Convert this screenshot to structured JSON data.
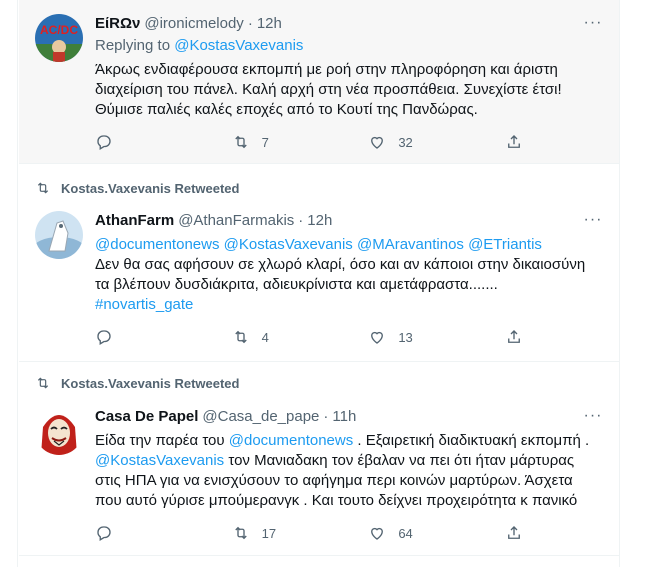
{
  "tweets": [
    {
      "author": "ΕίRΩν",
      "handle": "@ironicmelody",
      "dot": "·",
      "time": "12h",
      "replying_prefix": "Replying to",
      "replying_to": "@KostasVaxevanis",
      "lines": [
        "Άκρως ενδιαφέρουσα  εκπομπή με ροή στην πληροφόρηση και άριστη",
        "διαχείριση του πάνελ. Καλή αρχή στη νέα προσπάθεια. Συνεχίστε έτσι!",
        "Θύμισε παλιές καλές εποχές από το Κουτί της Πανδώρας."
      ],
      "retweets": "7",
      "likes": "32"
    },
    {
      "retweeted_by": "Kostas.Vaxevanis Retweeted",
      "author": "AthanFarm",
      "handle": "@AthanFarmakis",
      "dot": "·",
      "time": "12h",
      "mentions": "@documentonews  @KostasVaxevanis @MAravantinos @ETriantis",
      "lines": [
        "Δεν θα σας αφήσουν σε χλωρό κλαρί, όσο και αν κάποιοι στην δικαιοσύνη",
        "τα βλέπουν δυσδιάκριτα, αδιευκρίνιστα και αμετάφραστα......."
      ],
      "hashtag": "#novartis_gate",
      "retweets": "4",
      "likes": "13"
    },
    {
      "retweeted_by": "Kostas.Vaxevanis Retweeted",
      "author": "Casa De Papel",
      "handle": "@Casa_de_pape",
      "dot": "·",
      "time": "11h",
      "line1_pre": "Είδα την παρέα του ",
      "line1_link": "@documentonews",
      "line1_post": " . Εξαιρετική διαδικτυακή εκπομπή .",
      "line2_link": "@KostasVaxevanis",
      "line2_post": " τον  Μανιαδακη τον έβαλαν να πει ότι ήταν μάρτυρας",
      "lines": [
        "στις ΗΠΑ για να ενισχύσουν το αφήγημα περι κοινών μαρτύρων. Άσχετα",
        "που αυτό γύρισε μπούμερανγκ . Και τουτο δείχνει προχειρότητα κ πανικό"
      ],
      "retweets": "17",
      "likes": "64"
    }
  ],
  "icons": {
    "reply": "speech-bubble",
    "retweet": "two-arrows-loop",
    "like": "heart-outline",
    "share": "upload-arrow",
    "more": "three-dots"
  },
  "colors": {
    "link": "#1d9bf0",
    "secondary": "#536471",
    "hover_bg": "#f7f7f7"
  }
}
